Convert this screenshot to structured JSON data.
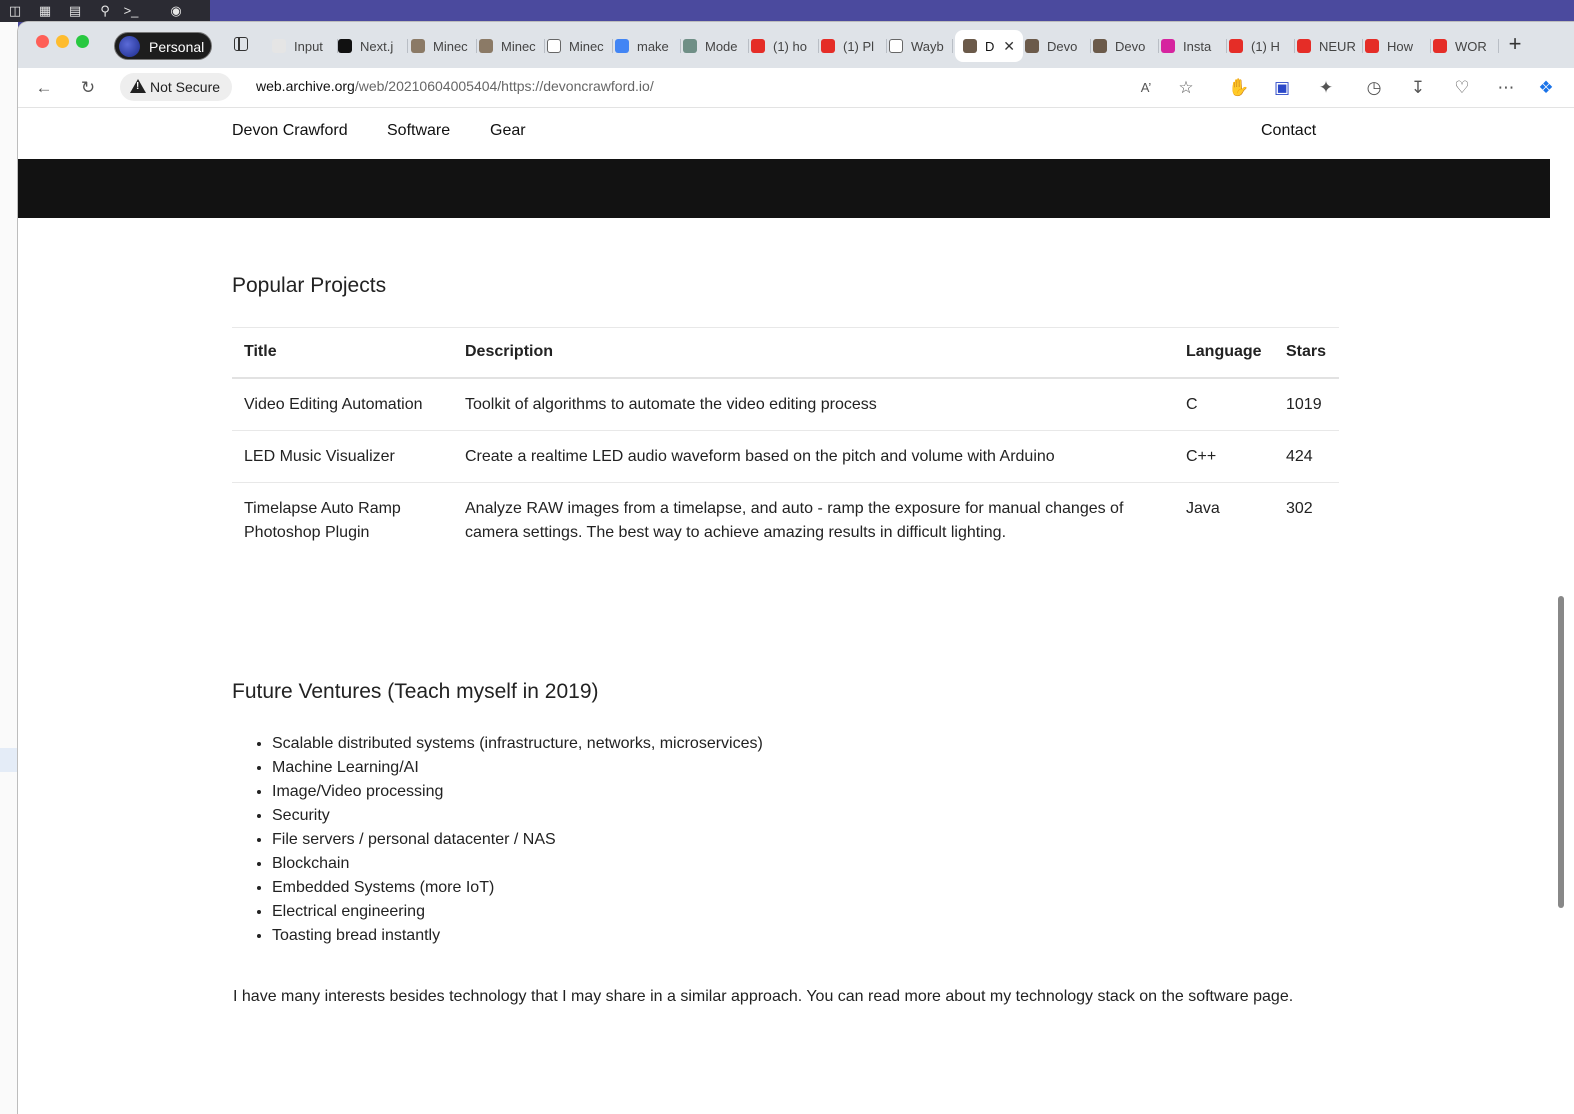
{
  "colors": {
    "accent_blue": "#1a73e8",
    "traffic_red": "#fe5f57",
    "traffic_yellow": "#febc2e",
    "traffic_green": "#28c840",
    "hero_bg": "#121212"
  },
  "browser": {
    "profile_label": "Personal",
    "tabs": [
      {
        "label": "Input",
        "icon": "ui-icon"
      },
      {
        "label": "Next.j",
        "icon": "vercel-icon"
      },
      {
        "label": "Minec",
        "icon": "image-icon"
      },
      {
        "label": "Minec",
        "icon": "image-icon"
      },
      {
        "label": "Minec",
        "icon": "doc-icon"
      },
      {
        "label": "make",
        "icon": "google-icon"
      },
      {
        "label": "Mode",
        "icon": "model-icon"
      },
      {
        "label": "(1) ho",
        "icon": "youtube-icon"
      },
      {
        "label": "(1) Pl",
        "icon": "youtube-icon"
      },
      {
        "label": "Wayb",
        "icon": "archive-icon"
      },
      {
        "label": "D",
        "icon": "avatar-icon"
      },
      {
        "label": "Devo",
        "icon": "avatar-icon"
      },
      {
        "label": "Devo",
        "icon": "avatar-icon"
      },
      {
        "label": "Insta",
        "icon": "instagram-icon"
      },
      {
        "label": "(1) H",
        "icon": "youtube-icon"
      },
      {
        "label": "NEUR",
        "icon": "youtube-icon"
      },
      {
        "label": "How",
        "icon": "youtube-icon"
      },
      {
        "label": "WOR",
        "icon": "youtube-icon"
      }
    ],
    "active_tab_index": 10,
    "security_label": "Not Secure",
    "url_host": "web.archive.org",
    "url_path": "/web/20210604005404/https://devoncrawford.io/"
  },
  "site_nav": {
    "brand": "Devon Crawford",
    "software": "Software",
    "gear": "Gear",
    "contact": "Contact"
  },
  "popular": {
    "heading": "Popular Projects",
    "columns": [
      "Title",
      "Description",
      "Language",
      "Stars"
    ],
    "rows": [
      {
        "title": "Video Editing Automation",
        "description": "Toolkit of algorithms to automate the video editing process",
        "language": "C",
        "stars": "1019"
      },
      {
        "title": "LED Music Visualizer",
        "description": "Create a realtime LED audio waveform based on the pitch and volume with Arduino",
        "language": "C++",
        "stars": "424"
      },
      {
        "title": "Timelapse Auto Ramp Photoshop Plugin",
        "description": "Analyze RAW images from a timelapse, and auto - ramp the exposure for manual changes of camera settings. The best way to achieve amazing results in difficult lighting.",
        "language": "Java",
        "stars": "302"
      }
    ]
  },
  "future": {
    "heading": "Future Ventures (Teach myself in 2019)",
    "items": [
      "Scalable distributed systems (infrastructure, networks, microservices)",
      "Machine Learning/AI",
      "Image/Video processing",
      "Security",
      "File servers / personal datacenter / NAS",
      "Blockchain",
      "Embedded Systems (more IoT)",
      "Electrical engineering",
      "Toasting bread instantly"
    ],
    "closing": "I have many interests besides technology that I may share in a similar approach. You can read more about my technology stack on the software page."
  }
}
